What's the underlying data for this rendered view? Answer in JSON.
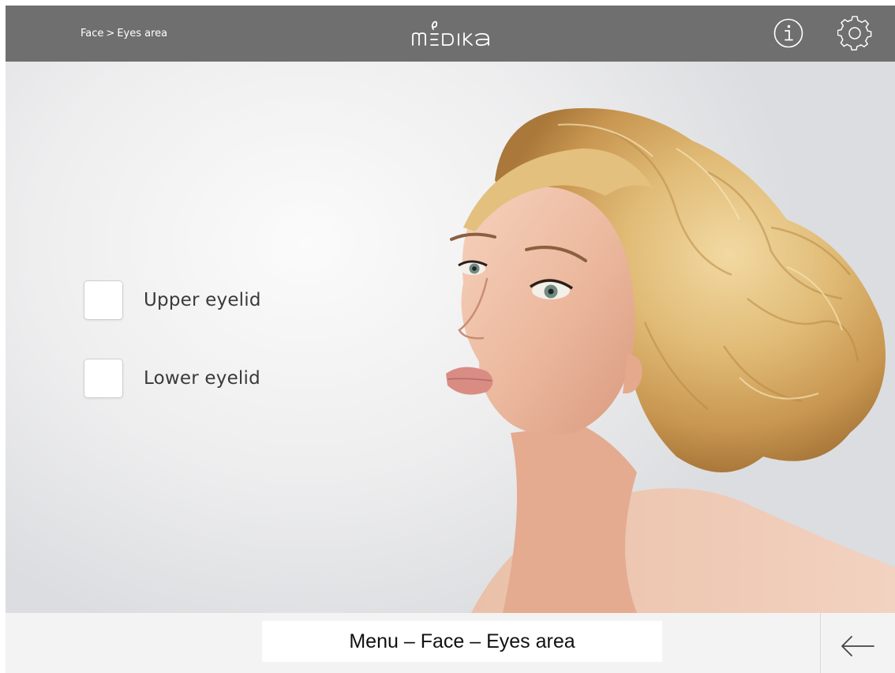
{
  "header": {
    "breadcrumb": {
      "items": [
        "Face",
        "Eyes area"
      ],
      "separator": ">"
    },
    "logo_text": "medika",
    "icons": {
      "info": "info-icon",
      "settings": "gear-icon"
    },
    "colors": {
      "bar": "#6f6f6f",
      "text": "#ffffff"
    }
  },
  "main": {
    "image": "woman-portrait-image",
    "options": [
      {
        "label": "Upper eyelid",
        "checked": false
      },
      {
        "label": "Lower eyelid",
        "checked": false
      }
    ]
  },
  "footer": {
    "caption": "Menu – Face – Eyes area",
    "back_icon": "arrow-left-icon"
  }
}
